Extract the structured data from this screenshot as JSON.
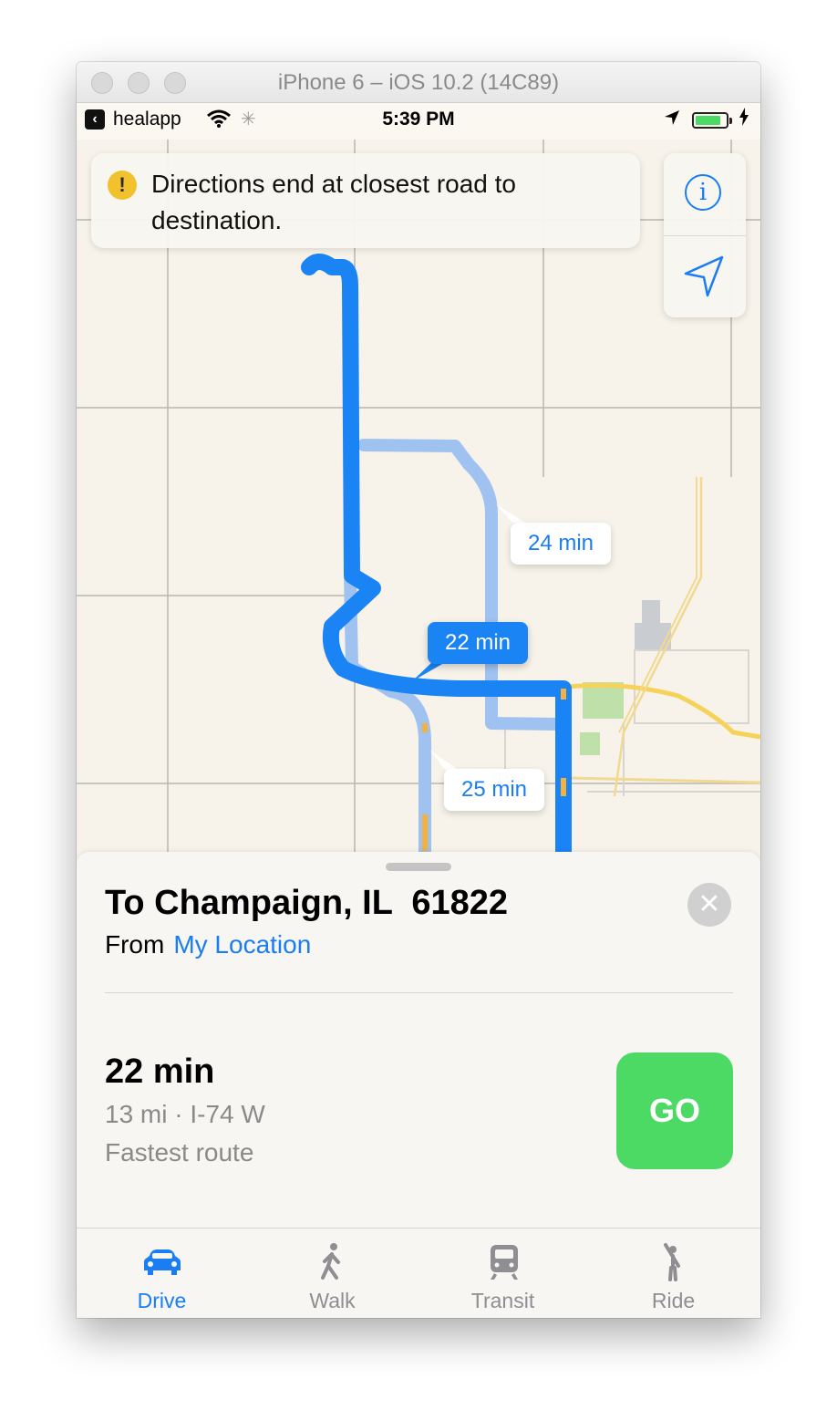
{
  "window": {
    "title": "iPhone 6 – iOS 10.2 (14C89)"
  },
  "status_bar": {
    "back_app": "healapp",
    "time": "5:39 PM",
    "battery_level": 0.85
  },
  "banner": {
    "message": "Directions end at closest road to destination."
  },
  "map": {
    "route_callouts": [
      {
        "label": "24 min",
        "selected": false
      },
      {
        "label": "22 min",
        "selected": true
      },
      {
        "label": "25 min",
        "selected": false
      }
    ]
  },
  "sheet": {
    "destination": "To Champaign, IL  61822",
    "from_label": "From",
    "from_value": "My Location",
    "route": {
      "time": "22 min",
      "detail": "13 mi · I-74 W",
      "note": "Fastest route"
    },
    "go_label": "GO"
  },
  "tabs": [
    {
      "label": "Drive",
      "icon": "car-icon",
      "active": true
    },
    {
      "label": "Walk",
      "icon": "walk-icon",
      "active": false
    },
    {
      "label": "Transit",
      "icon": "train-icon",
      "active": false
    },
    {
      "label": "Ride",
      "icon": "ride-hail-icon",
      "active": false
    }
  ],
  "colors": {
    "accent": "#1a7ef2",
    "route": "#1a84f5",
    "alt_route": "#9fc2f0",
    "go": "#4cd964",
    "warning": "#f2c12e"
  }
}
